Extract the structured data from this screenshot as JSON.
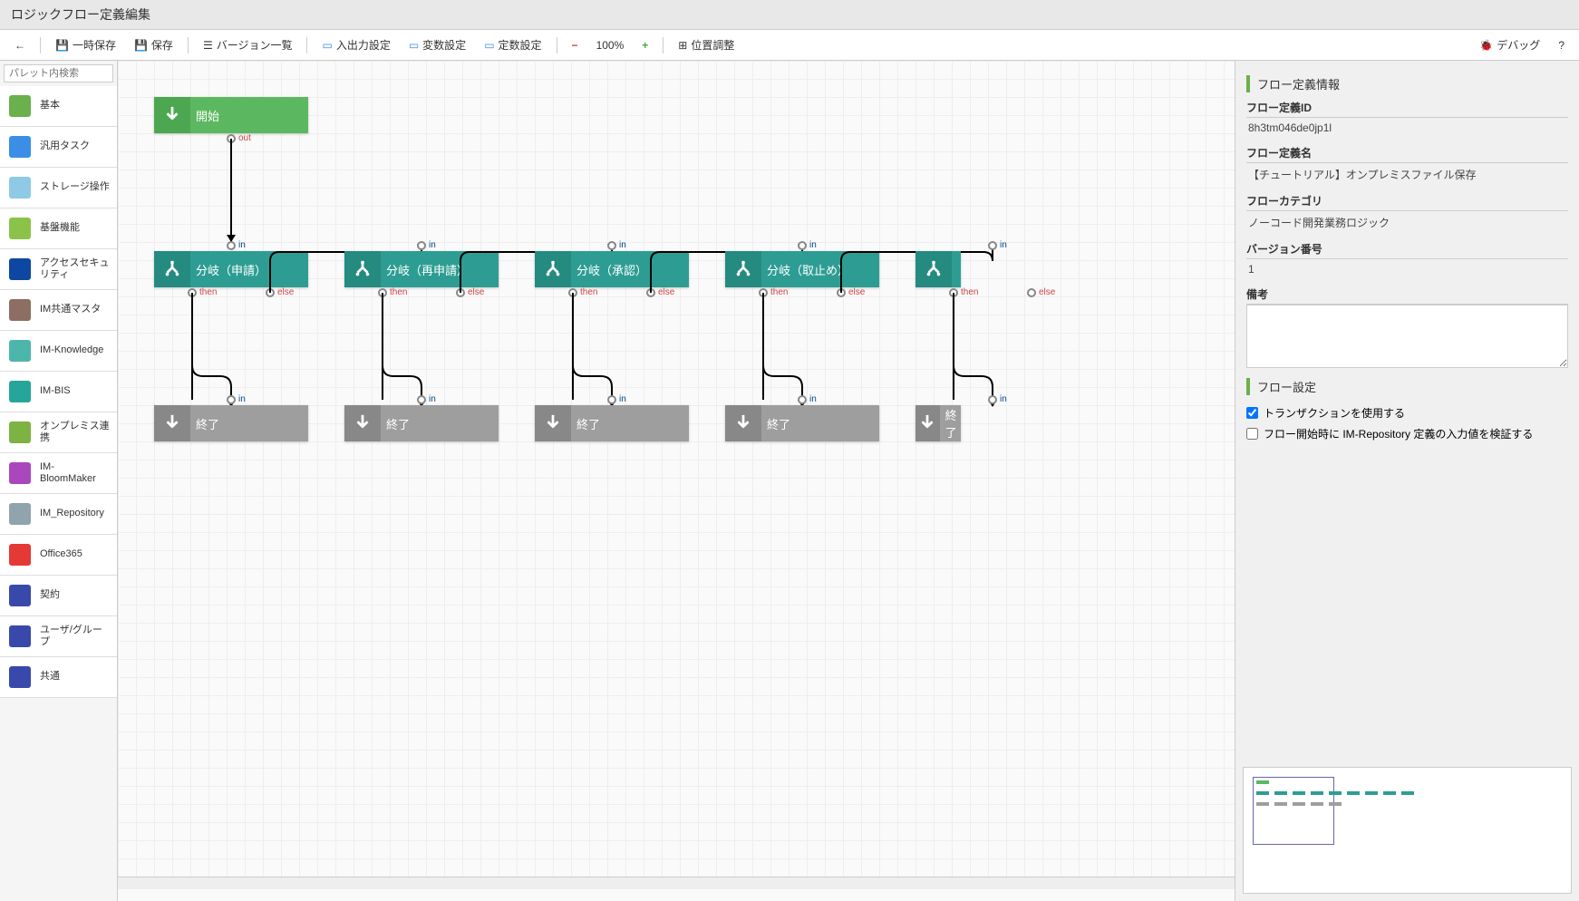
{
  "header": {
    "title": "ロジックフロー定義編集"
  },
  "toolbar": {
    "tempSave": "一時保存",
    "save": "保存",
    "versionList": "バージョン一覧",
    "ioSettings": "入出力設定",
    "varSettings": "変数設定",
    "constSettings": "定数設定",
    "zoom": "100%",
    "align": "位置調整",
    "debug": "デバッグ"
  },
  "palette": {
    "searchPlaceholder": "パレット内検索",
    "items": [
      {
        "label": "基本",
        "color": "#6ab04c"
      },
      {
        "label": "汎用タスク",
        "color": "#3a8ee6"
      },
      {
        "label": "ストレージ操作",
        "color": "#8ecae6"
      },
      {
        "label": "基盤機能",
        "color": "#8bc34a"
      },
      {
        "label": "アクセスセキュリティ",
        "color": "#0d47a1"
      },
      {
        "label": "IM共通マスタ",
        "color": "#8d6e63"
      },
      {
        "label": "IM-Knowledge",
        "color": "#4db6ac"
      },
      {
        "label": "IM-BIS",
        "color": "#26a69a"
      },
      {
        "label": "オンプレミス連携",
        "color": "#7cb342"
      },
      {
        "label": "IM-BloomMaker",
        "color": "#ab47bc"
      },
      {
        "label": "IM_Repository",
        "color": "#90a4ae"
      },
      {
        "label": "Office365",
        "color": "#e53935"
      },
      {
        "label": "契約",
        "color": "#3949ab"
      },
      {
        "label": "ユーザ/グループ",
        "color": "#3949ab"
      },
      {
        "label": "共通",
        "color": "#3949ab"
      }
    ]
  },
  "canvas": {
    "startNode": {
      "label": "開始"
    },
    "branchNodes": [
      {
        "label": "分岐（申請）"
      },
      {
        "label": "分岐（再申請）"
      },
      {
        "label": "分岐（承認）"
      },
      {
        "label": "分岐（取止め）"
      }
    ],
    "endLabel": "終了",
    "ports": {
      "out": "out",
      "in": "in",
      "then": "then",
      "else": "else"
    }
  },
  "rightPanel": {
    "section1Title": "フロー定義情報",
    "flowIdLabel": "フロー定義ID",
    "flowIdValue": "8h3tm046de0jp1l",
    "flowNameLabel": "フロー定義名",
    "flowNameValue": "【チュートリアル】オンプレミスファイル保存",
    "categoryLabel": "フローカテゴリ",
    "categoryValue": "ノーコード開発業務ロジック",
    "versionLabel": "バージョン番号",
    "versionValue": "1",
    "notesLabel": "備考",
    "section2Title": "フロー設定",
    "check1": "トランザクションを使用する",
    "check2": "フロー開始時に IM-Repository 定義の入力値を検証する"
  }
}
